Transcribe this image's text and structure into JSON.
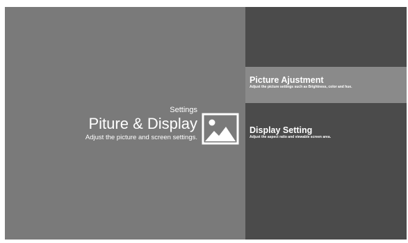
{
  "header": {
    "subtitle": "Settings",
    "title": "Piture & Display",
    "description": "Adjust the picture and screen settings."
  },
  "menu": {
    "items": [
      {
        "label": "Picture Ajustment",
        "description": "Adjust the picture settings such as Brightness, color and hue.",
        "selected": true
      },
      {
        "label": "Display Setting",
        "description": "Adjust the aspect ratio and viewable screen area.",
        "selected": false
      }
    ]
  },
  "colors": {
    "left_panel": "#7a7a7a",
    "right_panel": "#4b4b4b",
    "selected_item": "#8a8a8a",
    "text": "#ffffff"
  },
  "icons": {
    "header_icon": "picture-icon"
  }
}
